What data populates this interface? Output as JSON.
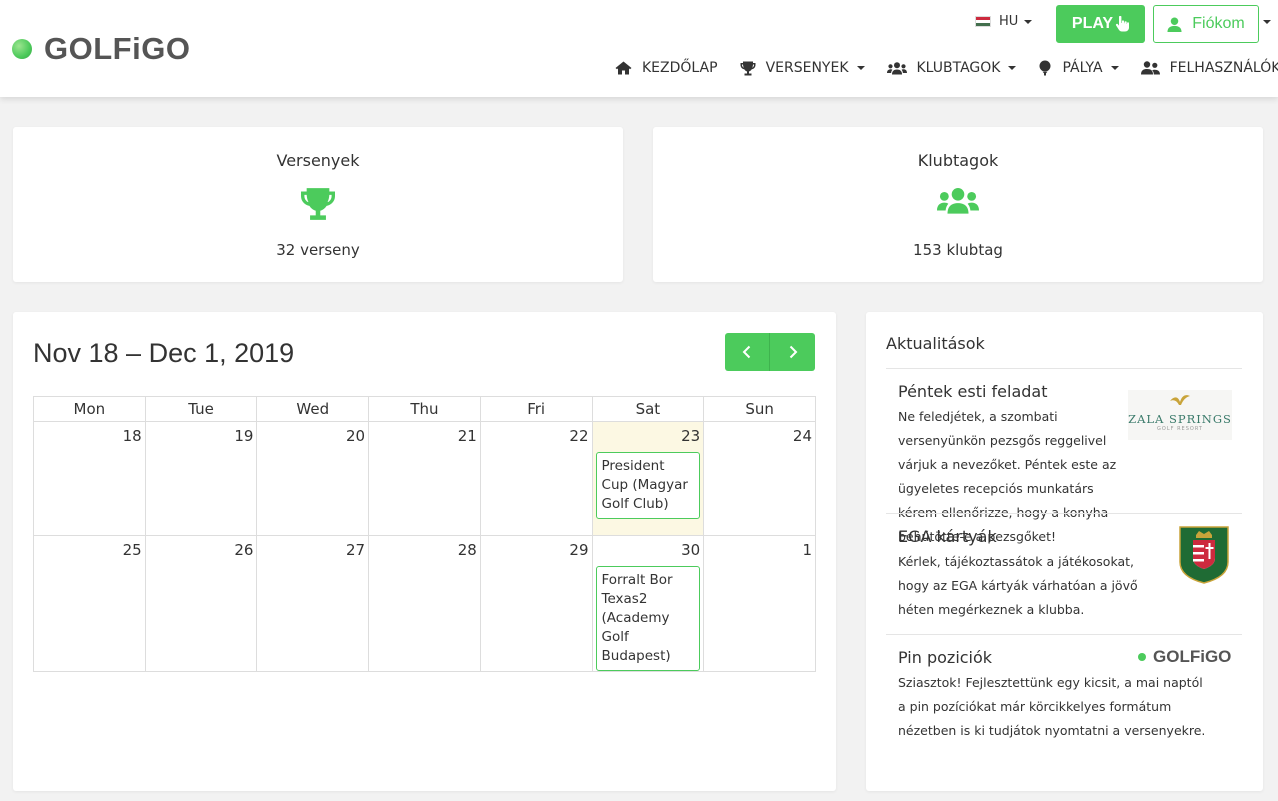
{
  "header": {
    "logo_text": "GOLFiGO",
    "language": "HU",
    "play_label": "PLAY",
    "account_label": "Fiókom",
    "nav": [
      {
        "label": "KEZDŐLAP",
        "icon": "home-icon"
      },
      {
        "label": "VERSENYEK",
        "icon": "trophy-icon",
        "dropdown": true
      },
      {
        "label": "KLUBTAGOK",
        "icon": "users-icon",
        "dropdown": true
      },
      {
        "label": "PÁLYA",
        "icon": "golf-icon",
        "dropdown": true
      },
      {
        "label": "FELHASZNÁLÓK",
        "icon": "user-friends-icon"
      }
    ]
  },
  "stats": {
    "tournaments": {
      "title": "Versenyek",
      "value": "32 verseny",
      "icon": "trophy-icon"
    },
    "members": {
      "title": "Klubtagok",
      "value": "153 klubtag",
      "icon": "users-icon"
    }
  },
  "calendar": {
    "title": "Nov 18 – Dec 1, 2019",
    "weekdays": [
      "Mon",
      "Tue",
      "Wed",
      "Thu",
      "Fri",
      "Sat",
      "Sun"
    ],
    "weeks": [
      {
        "days": [
          "18",
          "19",
          "20",
          "21",
          "22",
          "23",
          "24"
        ]
      },
      {
        "days": [
          "25",
          "26",
          "27",
          "28",
          "29",
          "30",
          "1"
        ]
      }
    ],
    "events": {
      "sat23": "President Cup (Magyar Golf Club)",
      "sat30": "Forralt Bor Texas2 (Academy Golf Budapest)"
    }
  },
  "news": {
    "title": "Aktualitások",
    "items": [
      {
        "title": "Péntek esti feladat",
        "body": "Ne feledjétek, a szombati versenyünkön pezsgős reggelivel várjuk a nevezőket. Péntek este az ügyeletes recepciós munkatárs kérem ellenőrizze, hogy a konyha behűtötte-e a pezsgőket!",
        "logo_text": "ZALA SPRINGS",
        "logo_subtext": "GOLF RESORT"
      },
      {
        "title": "EGA kártyák",
        "body": "Kérlek, tájékoztassátok a játékosokat, hogy az EGA kártyák várhatóan a jövő héten megérkeznek a klubba."
      },
      {
        "title": "Pin poziciók",
        "body": "Sziasztok! Fejlesztettünk egy kicsit, a mai naptól a pin pozíciókat már körcikkelyes formátum nézetben is ki tudjátok nyomtatni a versenyekre.",
        "logo_text": "GOLFiGO"
      }
    ]
  },
  "colors": {
    "accent": "#4ccb5c",
    "today": "#fcf8e3"
  }
}
